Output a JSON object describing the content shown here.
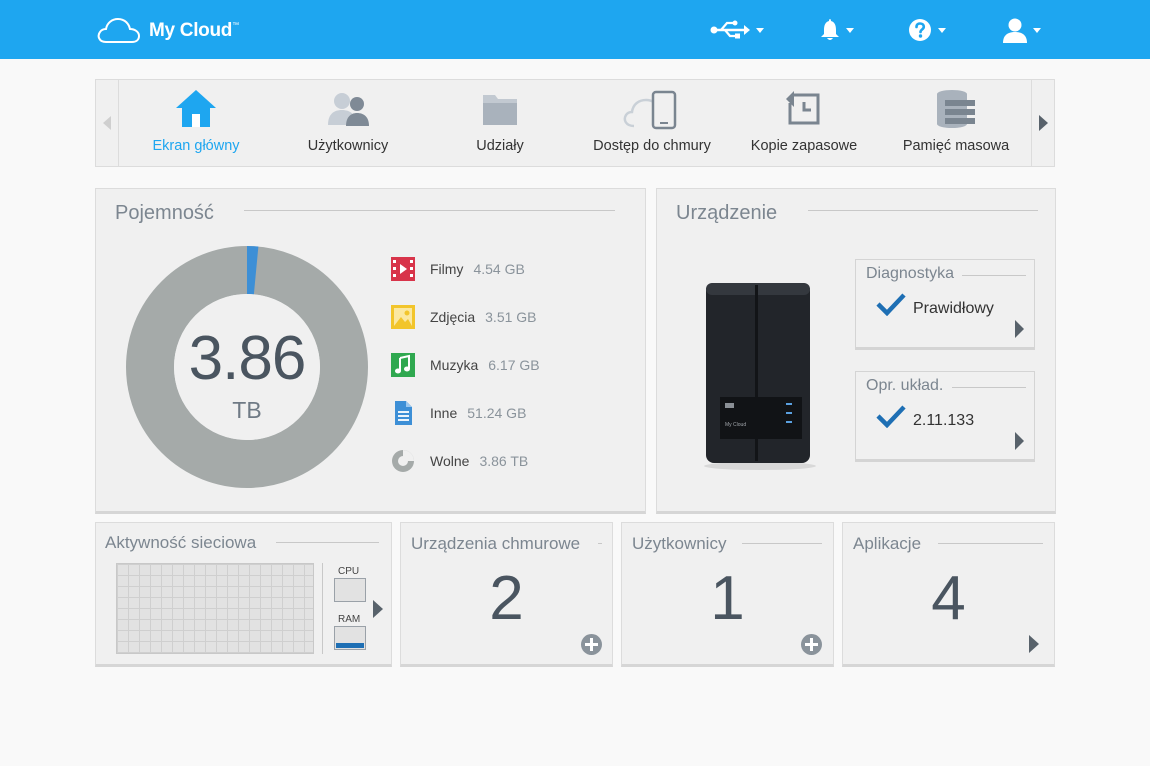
{
  "header": {
    "brand": "My Cloud",
    "trademark": "™",
    "color": "#1ea6f0",
    "icons": [
      "cloud-logo-icon",
      "usb-icon",
      "bell-icon",
      "help-icon",
      "user-icon"
    ]
  },
  "nav": {
    "items": [
      {
        "label": "Ekran główny",
        "icon": "home-icon",
        "active": true
      },
      {
        "label": "Użytkownicy",
        "icon": "users-icon"
      },
      {
        "label": "Udziały",
        "icon": "folder-icon"
      },
      {
        "label": "Dostęp do chmury",
        "icon": "cloud-access-icon"
      },
      {
        "label": "Kopie zapasowe",
        "icon": "backup-icon"
      },
      {
        "label": "Pamięć masowa",
        "icon": "storage-icon"
      }
    ]
  },
  "capacity": {
    "title": "Pojemność",
    "value": "3.86",
    "unit": "TB",
    "used_fraction": 0.015,
    "legend": [
      {
        "name": "Filmy",
        "value": "4.54 GB",
        "color": "#d8344a"
      },
      {
        "name": "Zdjęcia",
        "value": "3.51 GB",
        "color": "#f2c52b"
      },
      {
        "name": "Muzyka",
        "value": "6.17 GB",
        "color": "#2fa84f"
      },
      {
        "name": "Inne",
        "value": "51.24 GB",
        "color": "#3d8fd6"
      },
      {
        "name": "Wolne",
        "value": "3.86 TB",
        "color": "#a5aaa9"
      }
    ]
  },
  "device": {
    "title": "Urządzenie",
    "device_label": "My Cloud",
    "diagnostics": {
      "title": "Diagnostyka",
      "status": "Prawidłowy"
    },
    "firmware": {
      "title": "Opr. układ.",
      "version": "2.11.133"
    }
  },
  "network": {
    "title": "Aktywność sieciowa",
    "cpu_label": "CPU",
    "ram_label": "RAM",
    "ram_fraction": 0.25
  },
  "cloud_devices": {
    "title": "Urządzenia chmurowe",
    "count": "2"
  },
  "users": {
    "title": "Użytkownicy",
    "count": "1"
  },
  "apps": {
    "title": "Aplikacje",
    "count": "4"
  }
}
